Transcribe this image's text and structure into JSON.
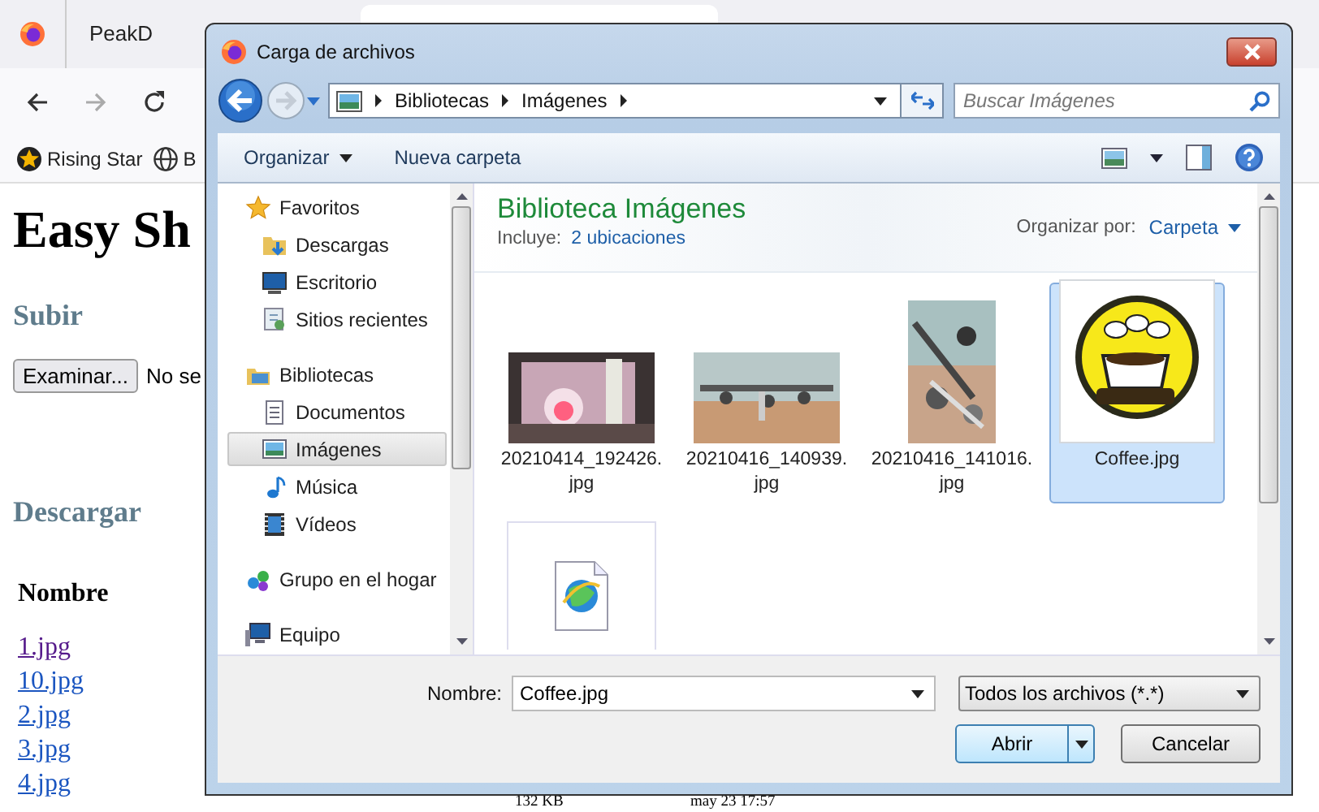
{
  "browser": {
    "tabs": [
      {
        "label": "PeakD",
        "selected": false
      },
      {
        "selected": true
      }
    ],
    "bookmarks": [
      {
        "label": "Rising Star",
        "kind": "star"
      },
      {
        "label": "B",
        "kind": "globe"
      }
    ]
  },
  "page": {
    "title": "Easy Sh",
    "upload_heading": "Subir",
    "browse_button": "Examinar...",
    "file_status": "No se",
    "download_heading": "Descargar",
    "table_header": "Nombre",
    "files": [
      "1.jpg",
      "10.jpg",
      "2.jpg",
      "3.jpg",
      "4.jpg"
    ],
    "size": "132 KB",
    "date": "may 23 17:57"
  },
  "dialog": {
    "title": "Carga de archivos",
    "breadcrumb": [
      "Bibliotecas",
      "Imágenes"
    ],
    "search": {
      "placeholder": "Buscar Imágenes"
    },
    "toolbar": [
      "Organizar",
      "Nueva carpeta"
    ],
    "nav": [
      {
        "label": "Favoritos",
        "kind": "star",
        "selected": false,
        "children": [
          {
            "label": "Descargas",
            "kind": "download",
            "selected": false
          },
          {
            "label": "Escritorio",
            "kind": "desktop",
            "selected": false
          },
          {
            "label": "Sitios recientes",
            "kind": "recent",
            "selected": false
          }
        ]
      },
      {
        "label": "Bibliotecas",
        "kind": "library",
        "selected": false,
        "children": [
          {
            "label": "Documentos",
            "kind": "document",
            "selected": false
          },
          {
            "label": "Imágenes",
            "kind": "images",
            "selected": true
          },
          {
            "label": "Música",
            "kind": "music",
            "selected": false
          },
          {
            "label": "Vídeos",
            "kind": "video",
            "selected": false
          }
        ]
      },
      {
        "label": "Grupo en el hogar",
        "kind": "homegroup",
        "selected": false
      },
      {
        "label": "Equipo",
        "kind": "computer",
        "selected": false
      }
    ],
    "library": {
      "title": "Biblioteca Imágenes",
      "includes_label": "Incluye:",
      "includes_link": "2 ubicaciones",
      "arrange_label": "Organizar por:",
      "arrange_value": "Carpeta"
    },
    "files": [
      {
        "name": "20210414_192426.jpg",
        "selected": false
      },
      {
        "name": "20210416_140939.jpg",
        "selected": false
      },
      {
        "name": "20210416_141016.jpg",
        "selected": false
      },
      {
        "name": "Coffee.jpg",
        "kind": "logo",
        "selected": true
      },
      {
        "kind": "document",
        "selected": false
      }
    ],
    "filename_label": "Nombre:",
    "filename": "Coffee.jpg",
    "filter": "Todos los archivos (*.*)",
    "buttons": [
      {
        "label": "Abrir",
        "kind": "split"
      },
      {
        "label": "Cancelar",
        "kind": "plain"
      }
    ]
  }
}
